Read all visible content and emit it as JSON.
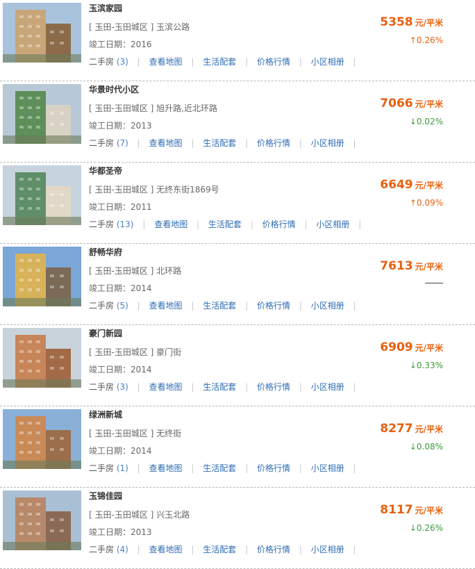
{
  "listings": [
    {
      "name": "玉滨家园",
      "address": "[ 玉田-玉田城区 ] 玉滨公路",
      "completion": "竣工日期：2016",
      "secondhand_label": "二手房",
      "secondhand_count": "(3)",
      "price": "5358",
      "unit": "元/平米",
      "change": "↑0.26%",
      "trend": "up"
    },
    {
      "name": "华景时代小区",
      "address": "[ 玉田-玉田城区 ] 旭升路,近北环路",
      "completion": "竣工日期：2013",
      "secondhand_label": "二手房",
      "secondhand_count": "(7)",
      "price": "7066",
      "unit": "元/平米",
      "change": "↓0.02%",
      "trend": "down"
    },
    {
      "name": "华都圣帝",
      "address": "[ 玉田-玉田城区 ] 无终东街1869号",
      "completion": "竣工日期：2011",
      "secondhand_label": "二手房",
      "secondhand_count": "(13)",
      "price": "6649",
      "unit": "元/平米",
      "change": "↑0.09%",
      "trend": "up"
    },
    {
      "name": "舒畅华府",
      "address": "[ 玉田-玉田城区 ] 北环路",
      "completion": "竣工日期：2014",
      "secondhand_label": "二手房",
      "secondhand_count": "(5)",
      "price": "7613",
      "unit": "元/平米",
      "change": "",
      "trend": "flat"
    },
    {
      "name": "豪门新园",
      "address": "[ 玉田-玉田城区 ] 豪门街",
      "completion": "竣工日期：2014",
      "secondhand_label": "二手房",
      "secondhand_count": "(3)",
      "price": "6909",
      "unit": "元/平米",
      "change": "↓0.33%",
      "trend": "down"
    },
    {
      "name": "绿洲新城",
      "address": "[ 玉田-玉田城区 ] 无终街",
      "completion": "竣工日期：2014",
      "secondhand_label": "二手房",
      "secondhand_count": "(1)",
      "price": "8277",
      "unit": "元/平米",
      "change": "↓0.08%",
      "trend": "down"
    },
    {
      "name": "玉锦佳园",
      "address": "[ 玉田-玉田城区 ] 兴玉北路",
      "completion": "竣工日期：2013",
      "secondhand_label": "二手房",
      "secondhand_count": "(4)",
      "price": "8117",
      "unit": "元/平米",
      "change": "↓0.26%",
      "trend": "down"
    }
  ],
  "links": [
    "查看地图",
    "生活配套",
    "价格行情",
    "小区相册",
    "小区"
  ],
  "colors": {
    "price": "#e8600f",
    "up": "#e8600f",
    "down": "#3a9a3a",
    "link": "#2f6db5"
  }
}
